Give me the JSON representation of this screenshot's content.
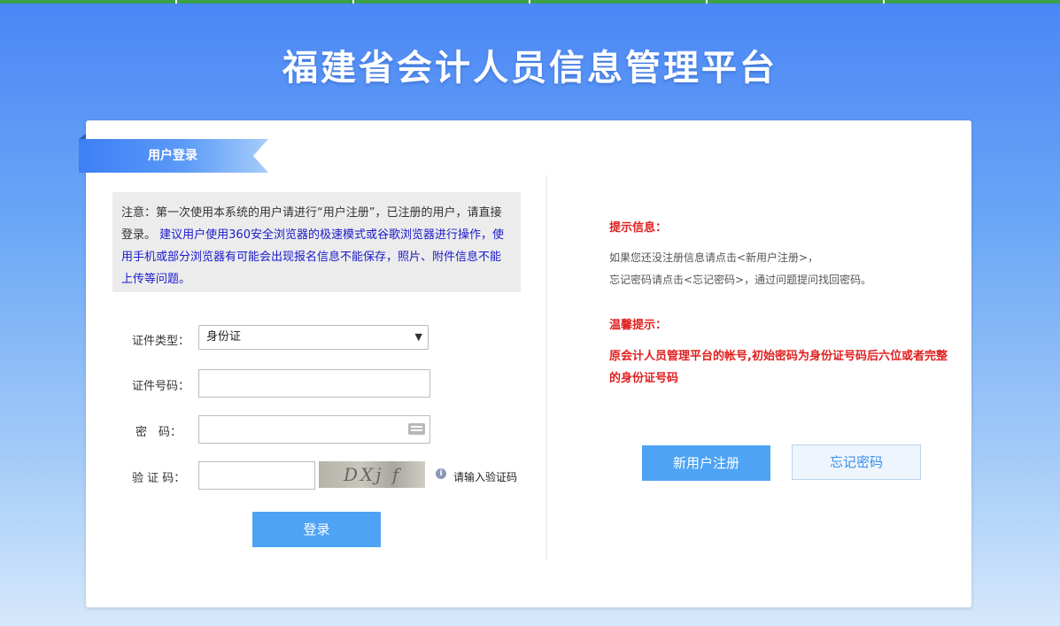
{
  "page_title": "福建省会计人员信息管理平台",
  "login_panel": {
    "ribbon_label": "用户登录",
    "notice": {
      "text_black": "注意：第一次使用本系统的用户请进行“用户注册”，已注册的用户，请直接登录。",
      "text_blue": "建议用户使用360安全浏览器的极速模式或谷歌浏览器进行操作，使用手机或部分浏览器有可能会出现报名信息不能保存，照片、附件信息不能上传等问题。"
    },
    "fields": {
      "id_type_label": "证件类型：",
      "id_type_value": "身份证",
      "id_number_label": "证件号码：",
      "password_label": "密　码：",
      "captcha_label": "验 证 码：",
      "captcha_image_text": "DXj f",
      "captcha_hint": "请输入验证码"
    },
    "login_button": "登录"
  },
  "info_panel": {
    "tip_title": "提示信息：",
    "tip_lines": [
      "如果您还没注册信息请点击<新用户注册>，",
      "忘记密码请点击<忘记密码>，通过问题提问找回密码。"
    ],
    "warm_title": "温馨提示：",
    "warm_text": "原会计人员管理平台的帐号,初始密码为身份证号码后六位或者完整的身份证号码",
    "register_button": "新用户注册",
    "forgot_button": "忘记密码"
  },
  "colors": {
    "primary_blue": "#4ea3f5",
    "warning_red": "#e02020",
    "notice_blue": "#1a1acc"
  }
}
